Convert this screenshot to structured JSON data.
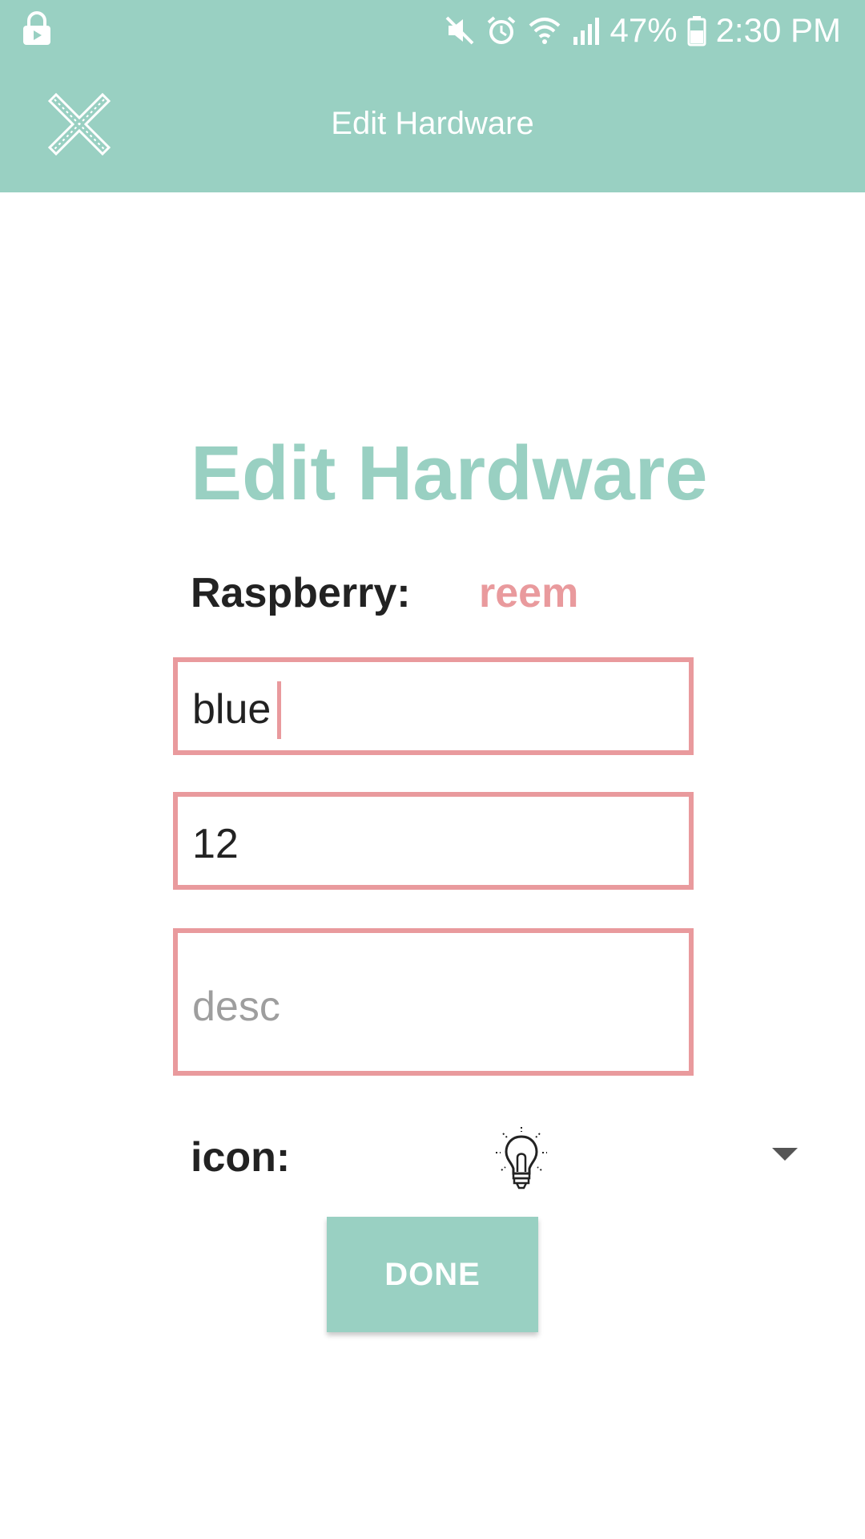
{
  "status_bar": {
    "battery_percent": "47%",
    "time": "2:30 PM"
  },
  "header": {
    "title": "Edit Hardware"
  },
  "main": {
    "title": "Edit Hardware",
    "raspberry_label": "Raspberry:",
    "raspberry_value": "reem",
    "name_value": "blue",
    "number_value": "12",
    "desc_placeholder": "desc",
    "icon_label": "icon:",
    "selected_icon": "lightbulb-icon",
    "done_label": "DONE"
  },
  "colors": {
    "primary": "#99d0c2",
    "accent": "#e99a9d",
    "text": "#222222"
  }
}
